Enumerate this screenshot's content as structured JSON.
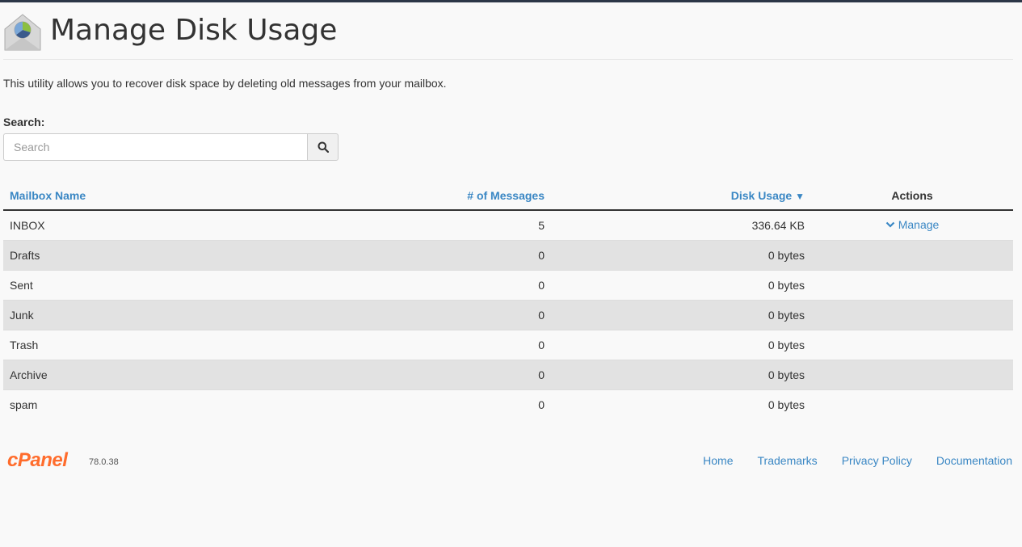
{
  "page": {
    "title": "Manage Disk Usage",
    "description": "This utility allows you to recover disk space by deleting old messages from your mailbox."
  },
  "search": {
    "label": "Search:",
    "placeholder": "Search",
    "value": "",
    "button_icon": "search-icon"
  },
  "table": {
    "columns": {
      "name": "Mailbox Name",
      "messages": "# of Messages",
      "usage": "Disk Usage",
      "usage_sort_indicator": "▼",
      "actions": "Actions"
    },
    "rows": [
      {
        "name": "INBOX",
        "messages": "5",
        "usage": "336.64 KB",
        "action": "Manage"
      },
      {
        "name": "Drafts",
        "messages": "0",
        "usage": "0 bytes",
        "action": ""
      },
      {
        "name": "Sent",
        "messages": "0",
        "usage": "0 bytes",
        "action": ""
      },
      {
        "name": "Junk",
        "messages": "0",
        "usage": "0 bytes",
        "action": ""
      },
      {
        "name": "Trash",
        "messages": "0",
        "usage": "0 bytes",
        "action": ""
      },
      {
        "name": "Archive",
        "messages": "0",
        "usage": "0 bytes",
        "action": ""
      },
      {
        "name": "spam",
        "messages": "0",
        "usage": "0 bytes",
        "action": ""
      }
    ]
  },
  "footer": {
    "logo_text": "cPanel",
    "version": "78.0.38",
    "links": [
      "Home",
      "Trademarks",
      "Privacy Policy",
      "Documentation"
    ]
  },
  "colors": {
    "link": "#3a87c4",
    "brand": "#ff6c2c",
    "stripe": "#e2e2e2",
    "background": "#f9f9f9"
  }
}
